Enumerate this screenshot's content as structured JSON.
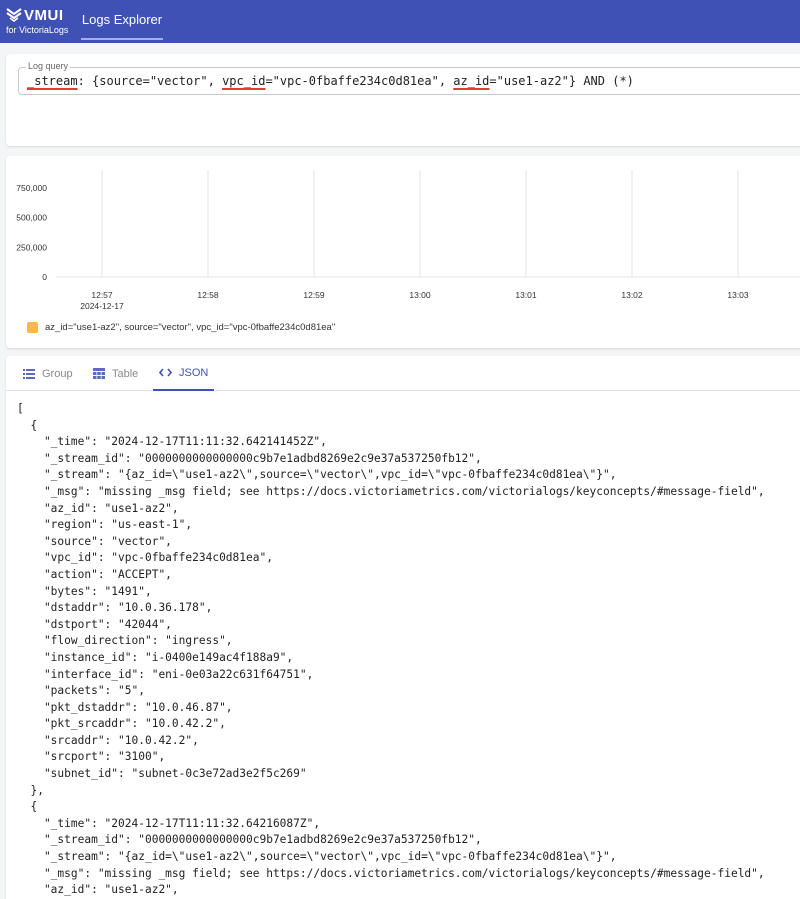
{
  "header": {
    "logo_text": "VMUI",
    "logo_sub": "for VictoriaLogs",
    "nav_tab": "Logs Explorer",
    "bg_color": "#3f51b5"
  },
  "query": {
    "label": "Log query",
    "text": "_stream: {source=\"vector\", vpc_id=\"vpc-0fbaffe234c0d81ea\", az_id=\"use1-az2\"} AND (*)"
  },
  "chart_data": {
    "type": "bar",
    "x": [
      "12:57",
      "12:58",
      "12:59",
      "13:00",
      "13:01",
      "13:02",
      "13:03"
    ],
    "x_date": "2024-12-17",
    "y_ticks": [
      "0",
      "250,000",
      "500,000",
      "750,000"
    ],
    "ylim": [
      0,
      900000
    ],
    "grid": true,
    "series": [
      {
        "name": "az_id=\"use1-az2\",  source=\"vector\",  vpc_id=\"vpc-0fbaffe234c0d81ea\"",
        "color": "#ffb74d",
        "values": []
      }
    ],
    "legend_position": "bottom-left"
  },
  "tabs": [
    {
      "label": "Group",
      "icon": "list-icon"
    },
    {
      "label": "Table",
      "icon": "table-icon"
    },
    {
      "label": "JSON",
      "icon": "code-icon"
    }
  ],
  "active_tab": "JSON",
  "json_lines": [
    "[",
    "  {",
    "    \"_time\": \"2024-12-17T11:11:32.642141452Z\",",
    "    \"_stream_id\": \"0000000000000000c9b7e1adbd8269e2c9e37a537250fb12\",",
    "    \"_stream\": \"{az_id=\\\"use1-az2\\\",source=\\\"vector\\\",vpc_id=\\\"vpc-0fbaffe234c0d81ea\\\"}\",",
    "    \"_msg\": \"missing _msg field; see https://docs.victoriametrics.com/victorialogs/keyconcepts/#message-field\",",
    "    \"az_id\": \"use1-az2\",",
    "    \"region\": \"us-east-1\",",
    "    \"source\": \"vector\",",
    "    \"vpc_id\": \"vpc-0fbaffe234c0d81ea\",",
    "    \"action\": \"ACCEPT\",",
    "    \"bytes\": \"1491\",",
    "    \"dstaddr\": \"10.0.36.178\",",
    "    \"dstport\": \"42044\",",
    "    \"flow_direction\": \"ingress\",",
    "    \"instance_id\": \"i-0400e149ac4f188a9\",",
    "    \"interface_id\": \"eni-0e03a22c631f64751\",",
    "    \"packets\": \"5\",",
    "    \"pkt_dstaddr\": \"10.0.46.87\",",
    "    \"pkt_srcaddr\": \"10.0.42.2\",",
    "    \"srcaddr\": \"10.0.42.2\",",
    "    \"srcport\": \"3100\",",
    "    \"subnet_id\": \"subnet-0c3e72ad3e2f5c269\"",
    "  },",
    "  {",
    "    \"_time\": \"2024-12-17T11:11:32.64216087Z\",",
    "    \"_stream_id\": \"0000000000000000c9b7e1adbd8269e2c9e37a537250fb12\",",
    "    \"_stream\": \"{az_id=\\\"use1-az2\\\",source=\\\"vector\\\",vpc_id=\\\"vpc-0fbaffe234c0d81ea\\\"}\",",
    "    \"_msg\": \"missing _msg field; see https://docs.victoriametrics.com/victorialogs/keyconcepts/#message-field\",",
    "    \"az_id\": \"use1-az2\","
  ]
}
